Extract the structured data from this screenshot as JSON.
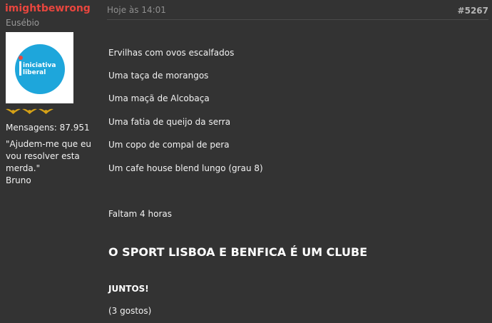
{
  "user": {
    "username": "imightbewrong",
    "title": "Eusébio",
    "avatar_text": [
      "iniciativa",
      "liberal"
    ],
    "rank_icons": [
      "eagle-icon",
      "eagle-icon",
      "eagle-icon"
    ],
    "messages": "Mensagens: 87.951",
    "signature_line1": "\"Ajudem-me que eu vou resolver esta merda.\"",
    "signature_line2": "Bruno"
  },
  "post": {
    "date": "Hoje às 14:01",
    "number": "#5267",
    "lines": [
      "Ervilhas com ovos escalfados",
      "Uma taça de morangos",
      "Uma maçã de Alcobaça",
      "Uma fatia de queijo da serra",
      "Um copo de compal de pera",
      "Um cafe house blend lungo (grau 8)"
    ],
    "countdown": "Faltam 4 horas",
    "headline": "O SPORT LISBOA E BENFICA É UM CLUBE",
    "bold_line": "JUNTOS!",
    "likes": " (3 gostos)"
  },
  "colors": {
    "background": "#333333",
    "username": "#e8463e",
    "avatar_blue": "#1ea6db",
    "rank_gold": "#d4a017"
  }
}
